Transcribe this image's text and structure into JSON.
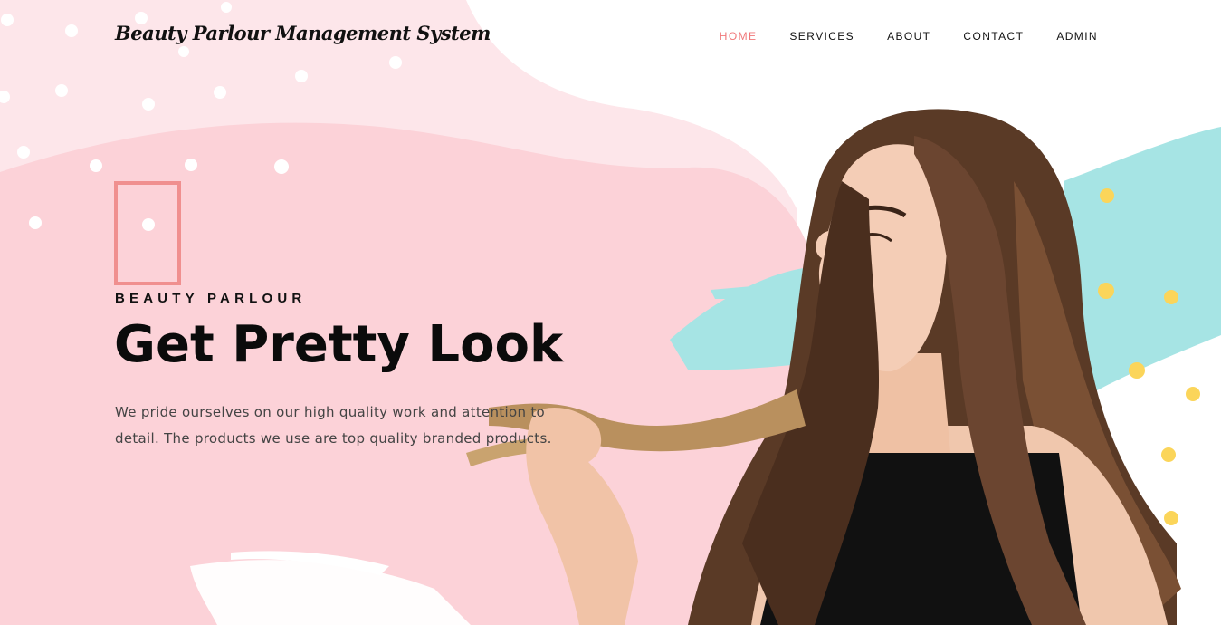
{
  "colors": {
    "pink_light": "#fde6ea",
    "pink": "#fcd2d8",
    "accent": "#f0787a",
    "teal": "#a6e4e4",
    "yellow": "#fbd55a",
    "text": "#111111"
  },
  "header": {
    "brand": "Beauty Parlour Management System",
    "nav": [
      "HOME",
      "SERVICES",
      "ABOUT",
      "CONTACT",
      "ADMIN"
    ],
    "active": "HOME"
  },
  "hero": {
    "eyebrow": "BEAUTY PARLOUR",
    "title": "Get Pretty Look",
    "description": "We pride ourselves on our high quality work and attention to detail. The products we use are top quality branded products."
  },
  "image": {
    "subject": "woman-with-long-hair-photo"
  }
}
